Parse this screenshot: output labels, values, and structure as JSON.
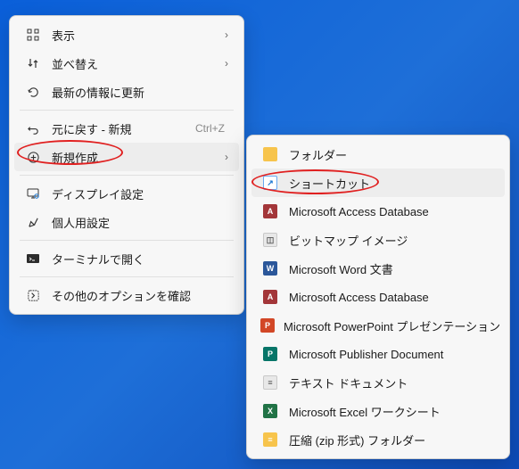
{
  "primaryMenu": {
    "items": [
      {
        "label": "表示",
        "icon": "view",
        "type": "item"
      },
      {
        "label": "並べ替え",
        "icon": "sort",
        "type": "item"
      },
      {
        "label": "最新の情報に更新",
        "icon": "refresh",
        "type": "item"
      },
      {
        "type": "divider"
      },
      {
        "label": "元に戻す - 新規",
        "icon": "undo",
        "shortcut": "Ctrl+Z",
        "type": "item"
      },
      {
        "label": "新規作成",
        "icon": "add",
        "type": "submenu",
        "hovered": true
      },
      {
        "type": "divider"
      },
      {
        "label": "ディスプレイ設定",
        "icon": "display",
        "type": "item"
      },
      {
        "label": "個人用設定",
        "icon": "personalize",
        "type": "item"
      },
      {
        "type": "divider"
      },
      {
        "label": "ターミナルで開く",
        "icon": "terminal",
        "type": "item"
      },
      {
        "type": "divider"
      },
      {
        "label": "その他のオプションを確認",
        "icon": "more",
        "type": "item"
      }
    ]
  },
  "submenu": {
    "items": [
      {
        "label": "フォルダー",
        "icon": "folder"
      },
      {
        "label": "ショートカット",
        "icon": "shortcut-ic",
        "hovered": true
      },
      {
        "label": "Microsoft Access Database",
        "icon": "access"
      },
      {
        "label": "ビットマップ イメージ",
        "icon": "bmp"
      },
      {
        "label": "Microsoft Word 文書",
        "icon": "word"
      },
      {
        "label": "Microsoft Access Database",
        "icon": "access"
      },
      {
        "label": "Microsoft PowerPoint プレゼンテーション",
        "icon": "ppt"
      },
      {
        "label": "Microsoft Publisher Document",
        "icon": "pub"
      },
      {
        "label": "テキスト ドキュメント",
        "icon": "txt"
      },
      {
        "label": "Microsoft Excel ワークシート",
        "icon": "xls"
      },
      {
        "label": "圧縮 (zip 形式) フォルダー",
        "icon": "zip"
      }
    ]
  }
}
